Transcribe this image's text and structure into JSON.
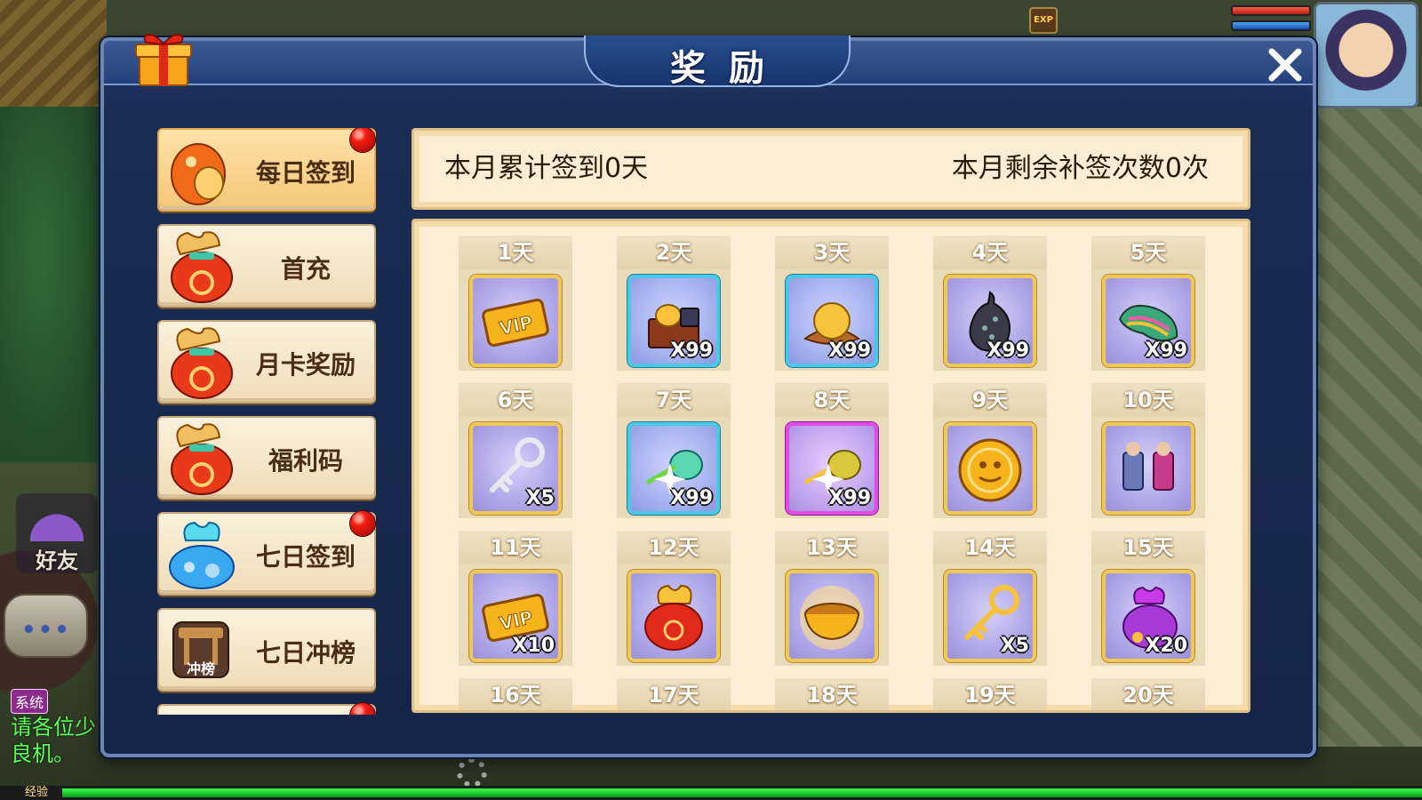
{
  "hud": {
    "exp_icon_text": "EXP",
    "friend_label": "好友",
    "chat_dots": "•••",
    "chat_system_tag": "系统",
    "chat_line1": "请各位少",
    "chat_line2": "良机。",
    "exp_label": "经验"
  },
  "modal": {
    "title": "奖励"
  },
  "menu": [
    {
      "label": "每日签到",
      "icon": "coin-pouch-icon",
      "active": true,
      "dot": true
    },
    {
      "label": "首充",
      "icon": "lucky-bag-icon",
      "active": false,
      "dot": false
    },
    {
      "label": "月卡奖励",
      "icon": "lucky-bag-icon",
      "active": false,
      "dot": false
    },
    {
      "label": "福利码",
      "icon": "lucky-bag-icon",
      "active": false,
      "dot": false
    },
    {
      "label": "七日签到",
      "icon": "blue-pouch-icon",
      "active": false,
      "dot": true
    },
    {
      "label": "七日冲榜",
      "icon": "ranking-icon",
      "active": false,
      "dot": false,
      "icon_text": "冲榜"
    }
  ],
  "info": {
    "cumulative": "本月累计签到0天",
    "remaining": "本月剩余补签次数0次"
  },
  "days": [
    {
      "day": "1天",
      "item": "vip-card-icon",
      "qty": "",
      "frame": "gold"
    },
    {
      "day": "2天",
      "item": "treasure-chest-icon",
      "qty": "X99",
      "frame": "blue"
    },
    {
      "day": "3天",
      "item": "golden-fruit-icon",
      "qty": "X99",
      "frame": "blue"
    },
    {
      "day": "4天",
      "item": "dark-gourd-icon",
      "qty": "X99",
      "frame": "gold"
    },
    {
      "day": "5天",
      "item": "rainbow-bean-icon",
      "qty": "X99",
      "frame": "gold"
    },
    {
      "day": "6天",
      "item": "silver-key-icon",
      "qty": "X5",
      "frame": "gold"
    },
    {
      "day": "7天",
      "item": "sparkle-gem-icon",
      "qty": "X99",
      "frame": "blue"
    },
    {
      "day": "8天",
      "item": "sparkle-gem-gold-icon",
      "qty": "X99",
      "frame": "purple"
    },
    {
      "day": "9天",
      "item": "gold-coin-icon",
      "qty": "",
      "frame": "gold"
    },
    {
      "day": "10天",
      "item": "warrior-figures-icon",
      "qty": "",
      "frame": "gold"
    },
    {
      "day": "11天",
      "item": "vip-card-icon",
      "qty": "X10",
      "frame": "gold"
    },
    {
      "day": "12天",
      "item": "red-lucky-bag-icon",
      "qty": "",
      "frame": "gold"
    },
    {
      "day": "13天",
      "item": "golden-bowl-icon",
      "qty": "",
      "frame": "gold"
    },
    {
      "day": "14天",
      "item": "gold-key-icon",
      "qty": "X5",
      "frame": "gold"
    },
    {
      "day": "15天",
      "item": "purple-pouch-icon",
      "qty": "X20",
      "frame": "gold"
    },
    {
      "day": "16天",
      "item": "",
      "qty": "",
      "frame": "gold"
    },
    {
      "day": "17天",
      "item": "",
      "qty": "",
      "frame": "gold"
    },
    {
      "day": "18天",
      "item": "",
      "qty": "",
      "frame": "gold"
    },
    {
      "day": "19天",
      "item": "",
      "qty": "",
      "frame": "gold"
    },
    {
      "day": "20天",
      "item": "",
      "qty": "",
      "frame": "gold"
    }
  ],
  "colors": {
    "modal_bg": "#1a2c54",
    "panel_bg": "#fbeed4",
    "menu_text": "#4a2e14",
    "red_dot": "#f01c10"
  }
}
